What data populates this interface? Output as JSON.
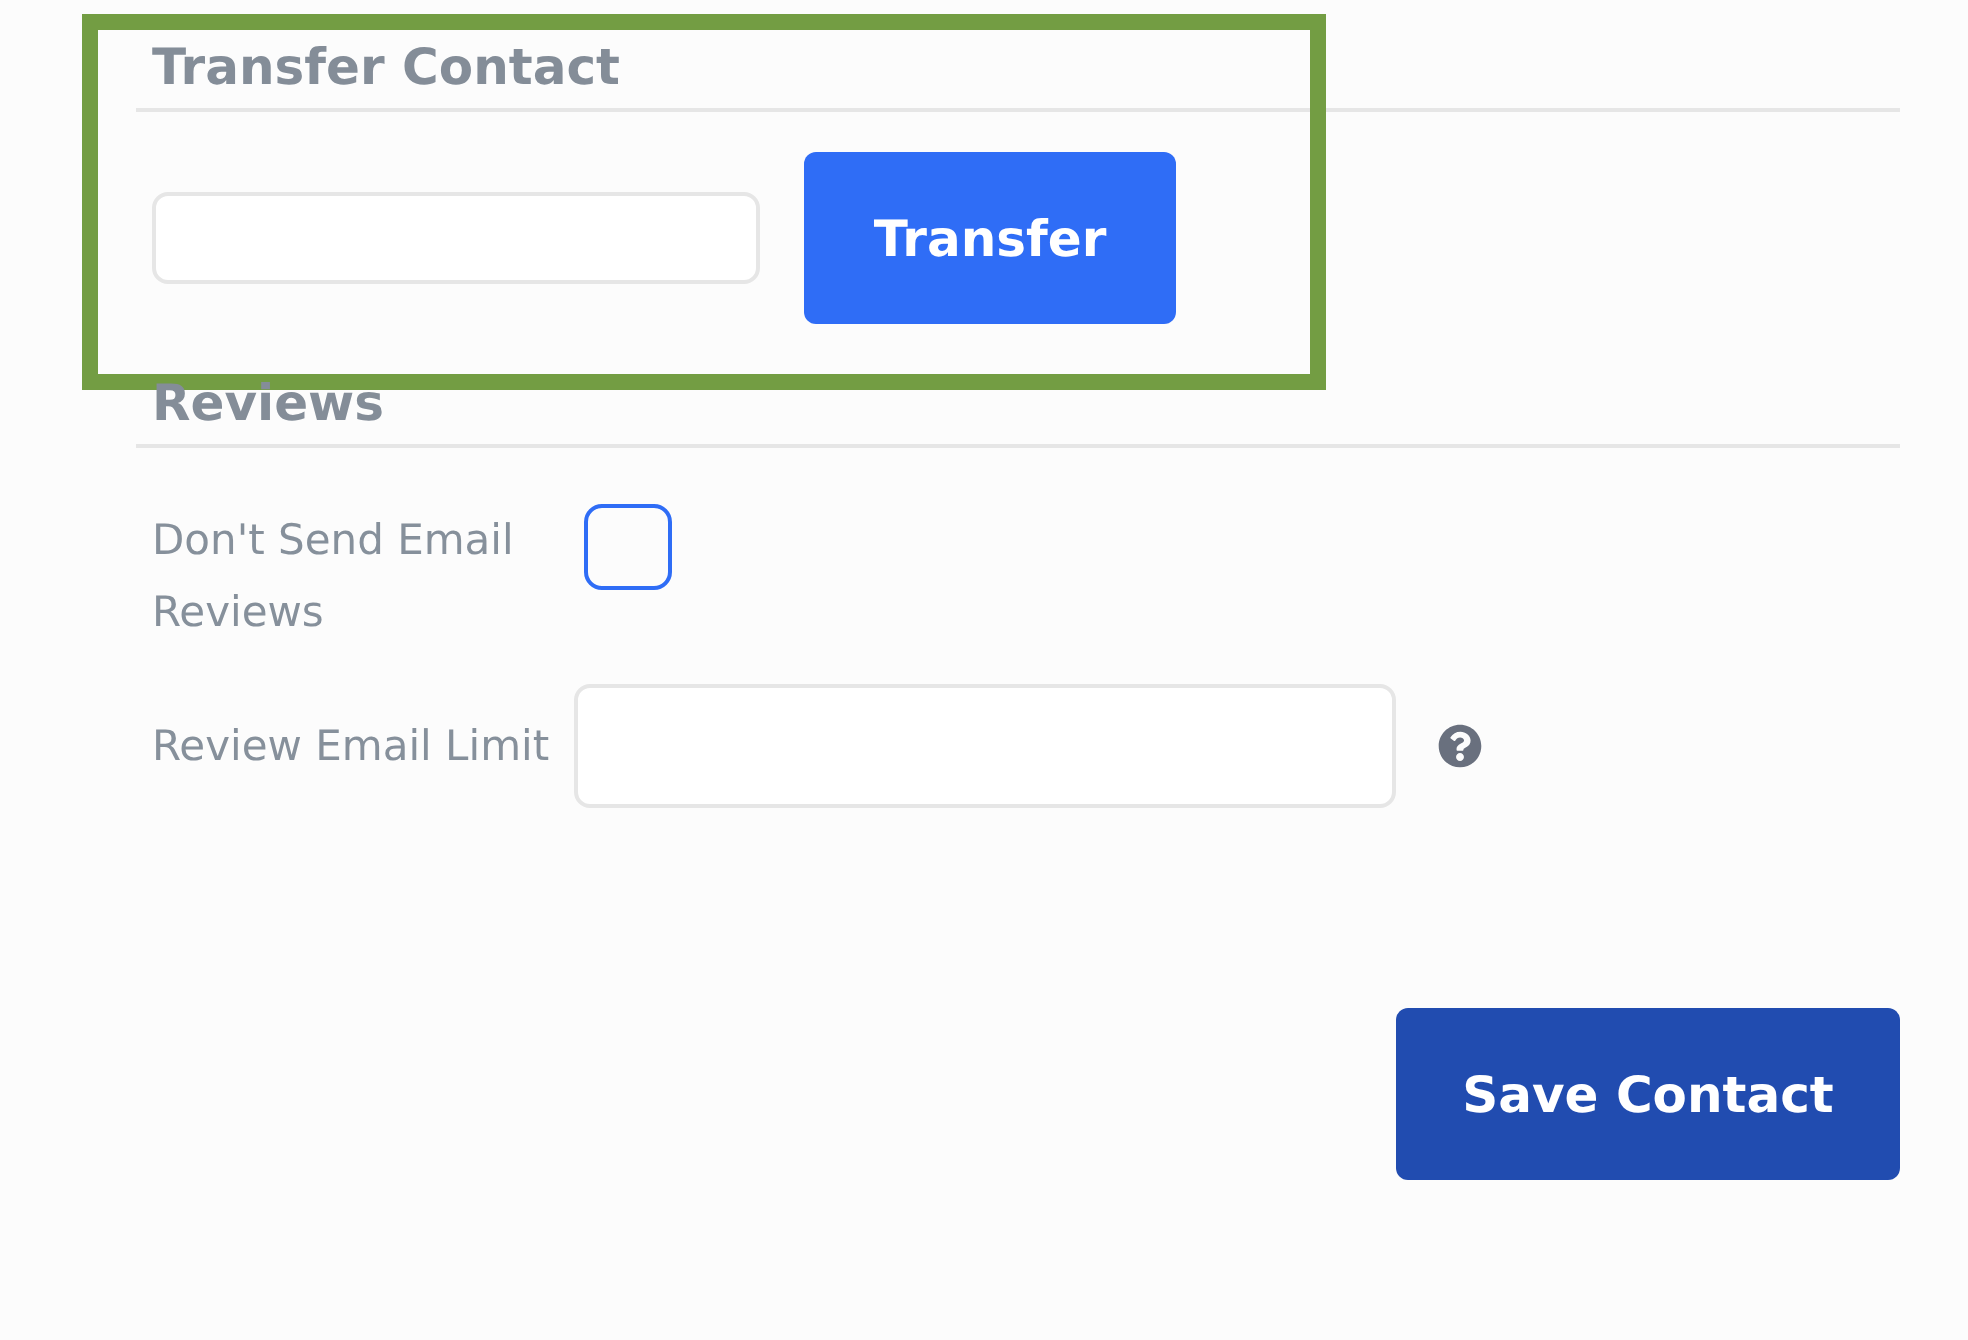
{
  "transfer_section": {
    "heading": "Transfer Contact",
    "highlighted": true,
    "button": "Transfer"
  },
  "reviews_section": {
    "heading": "Reviews",
    "fields": [
      {
        "kind": "checkbox",
        "label": "Don't Send Email Reviews",
        "checked": false
      },
      {
        "kind": "text",
        "label": "Review Email Limit",
        "help": true
      }
    ]
  },
  "save_button": "Save Contact"
}
